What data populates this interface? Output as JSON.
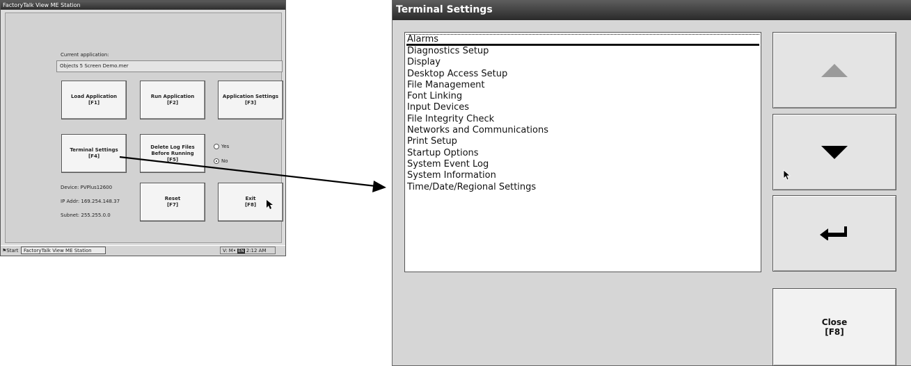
{
  "ft_station": {
    "title": "FactoryTalk View ME Station",
    "current_application_label": "Current application:",
    "current_application_value": "Objects 5 Screen Demo.mer",
    "buttons": {
      "load": {
        "line1": "Load Application",
        "line2": "[F1]"
      },
      "run": {
        "line1": "Run Application",
        "line2": "[F2]"
      },
      "app_settings": {
        "line1": "Application Settings",
        "line2": "[F3]"
      },
      "terminal_settings": {
        "line1": "Terminal Settings",
        "line2": "[F4]"
      },
      "delete_logs": {
        "line1": "Delete Log Files",
        "line2": "Before Running",
        "line3": "[F5]"
      },
      "reset": {
        "line1": "Reset",
        "line2": "[F7]"
      },
      "exit": {
        "line1": "Exit",
        "line2": "[F8]"
      }
    },
    "radio": {
      "yes": "Yes",
      "no": "No",
      "selected": "No"
    },
    "device": "Device: PVPlus12600",
    "ip_addr": "IP Addr: 169.254.148.37",
    "subnet": "Subnet: 255.255.0.0",
    "taskbar": {
      "start": "Start",
      "task": "FactoryTalk View ME Station",
      "tray_prefix": "V: M•",
      "lang": "EN",
      "clock": "2:12 AM"
    }
  },
  "terminal_settings": {
    "title": "Terminal Settings",
    "items": [
      "Alarms",
      "Diagnostics Setup",
      "Display",
      "Desktop Access Setup",
      "File Management",
      "Font Linking",
      "Input Devices",
      "File Integrity Check",
      "Networks and Communications",
      "Print Setup",
      "Startup Options",
      "System Event Log",
      "System Information",
      "Time/Date/Regional Settings"
    ],
    "selected_item": "Alarms",
    "close_button": {
      "line1": "Close",
      "line2": "[F8]"
    }
  },
  "colors": {
    "titlebar": "#2a2a2a",
    "panel_bg": "#d6d6d6",
    "list_bg": "#ffffff"
  },
  "icons": {
    "up": "triangle-up-icon",
    "down": "triangle-down-icon",
    "enter": "enter-arrow-icon",
    "pointer": "mouse-pointer-icon"
  }
}
